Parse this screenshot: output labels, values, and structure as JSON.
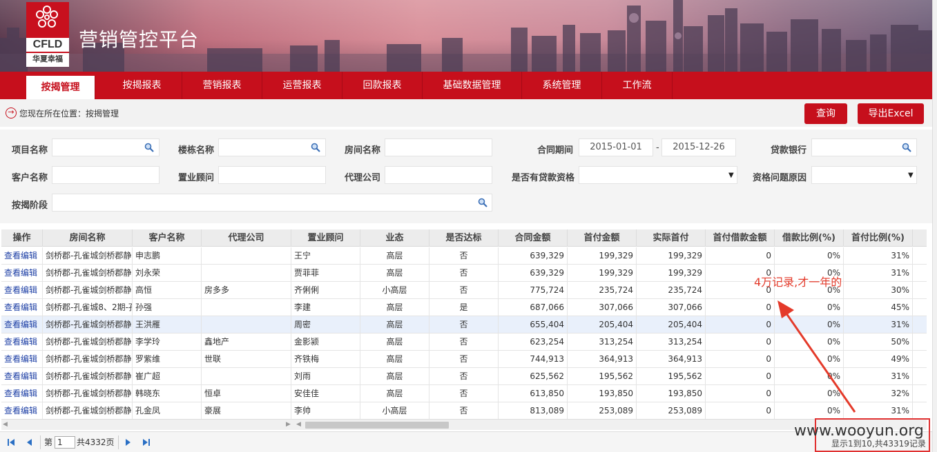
{
  "header": {
    "logo_en": "CFLD",
    "logo_cn": "华夏幸福",
    "title": "营销管控平台"
  },
  "nav": [
    {
      "label": "按揭管理",
      "active": true
    },
    {
      "label": "按揭报表"
    },
    {
      "label": "营销报表"
    },
    {
      "label": "运营报表"
    },
    {
      "label": "回款报表"
    },
    {
      "label": "基础数据管理"
    },
    {
      "label": "系统管理"
    },
    {
      "label": "工作流"
    }
  ],
  "breadcrumb": {
    "text": "您现在所在位置：按揭管理"
  },
  "actions": {
    "query": "查询",
    "export": "导出Excel"
  },
  "form": {
    "project_name": "项目名称",
    "building_name": "楼栋名称",
    "room_name": "房间名称",
    "contract_period": "合同期间",
    "date_from": "2015-01-01",
    "date_sep": "-",
    "date_to": "2015-12-26",
    "loan_bank": "贷款银行",
    "customer_name": "客户名称",
    "consultant": "置业顾问",
    "agency": "代理公司",
    "loan_qualified": "是否有贷款资格",
    "qual_reason": "资格问题原因",
    "mortgage_stage": "按揭阶段"
  },
  "table": {
    "columns": [
      "操作",
      "房间名称",
      "客户名称",
      "代理公司",
      "置业顾问",
      "业态",
      "是否达标",
      "合同金额",
      "首付金额",
      "实际首付",
      "首付借款金额",
      "借款比例(%)",
      "首付比例(%)"
    ],
    "rows": [
      [
        "查看|编辑",
        "剑桥郡-孔雀城剑桥郡静",
        "申志鹏",
        "",
        "王宁",
        "高层",
        "否",
        "639,329",
        "199,329",
        "199,329",
        "0",
        "0%",
        "31%"
      ],
      [
        "查看|编辑",
        "剑桥郡-孔雀城剑桥郡静",
        "刘永荣",
        "",
        "贾菲菲",
        "高层",
        "否",
        "639,329",
        "199,329",
        "199,329",
        "0",
        "0%",
        "31%"
      ],
      [
        "查看|编辑",
        "剑桥郡-孔雀城剑桥郡静",
        "高恒",
        "房多多",
        "齐俐俐",
        "小高层",
        "否",
        "775,724",
        "235,724",
        "235,724",
        "0",
        "0%",
        "30%"
      ],
      [
        "查看|编辑",
        "剑桥郡-孔雀城8、2期-孔",
        "孙强",
        "",
        "李建",
        "高层",
        "是",
        "687,066",
        "307,066",
        "307,066",
        "0",
        "0%",
        "45%"
      ],
      [
        "查看|编辑",
        "剑桥郡-孔雀城剑桥郡静",
        "王洪雁",
        "",
        "周密",
        "高层",
        "否",
        "655,404",
        "205,404",
        "205,404",
        "0",
        "0%",
        "31%"
      ],
      [
        "查看|编辑",
        "剑桥郡-孔雀城剑桥郡静",
        "李学玲",
        "鑫地产",
        "金影颍",
        "高层",
        "否",
        "623,254",
        "313,254",
        "313,254",
        "0",
        "0%",
        "50%"
      ],
      [
        "查看|编辑",
        "剑桥郡-孔雀城剑桥郡静",
        "罗紫维",
        "世联",
        "齐铁梅",
        "高层",
        "否",
        "744,913",
        "364,913",
        "364,913",
        "0",
        "0%",
        "49%"
      ],
      [
        "查看|编辑",
        "剑桥郡-孔雀城剑桥郡静",
        "崔广超",
        "",
        "刘雨",
        "高层",
        "否",
        "625,562",
        "195,562",
        "195,562",
        "0",
        "0%",
        "31%"
      ],
      [
        "查看|编辑",
        "剑桥郡-孔雀城剑桥郡静",
        "韩晓东",
        "恒卓",
        "安佳佳",
        "高层",
        "否",
        "613,850",
        "193,850",
        "193,850",
        "0",
        "0%",
        "32%"
      ],
      [
        "查看|编辑",
        "剑桥郡-孔雀城剑桥郡静",
        "孔金凤",
        "豪展",
        "李帅",
        "小高层",
        "否",
        "813,089",
        "253,089",
        "253,089",
        "0",
        "0%",
        "31%"
      ]
    ],
    "highlight_row": 4
  },
  "pager": {
    "page_prefix": "第",
    "page_value": "1",
    "total_pages": "共4332页",
    "summary": "显示1到10,共43319记录"
  },
  "annotation": "4万记录,才一年的",
  "watermark": "www.wooyun.org",
  "colors": {
    "brand_red": "#c60f1c",
    "link_blue": "#1d3fa5",
    "annotation_red": "#e43a2a"
  }
}
